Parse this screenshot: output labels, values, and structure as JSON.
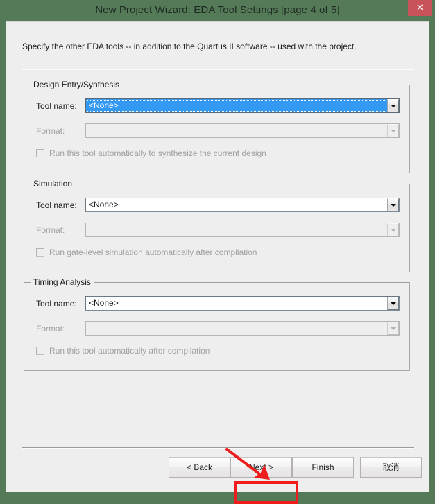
{
  "window": {
    "title": "New Project Wizard: EDA Tool Settings [page 4 of 5]",
    "close_icon": "close-icon",
    "close_glyph": "✕",
    "frame_color": "#557a58",
    "close_button_color": "#c8545a",
    "client_background": "#efeeee"
  },
  "intro": {
    "text": "Specify the other EDA tools -- in addition to the Quartus II software -- used with the project."
  },
  "groups": [
    {
      "legend": "Design Entry/Synthesis",
      "tool_label": "Tool name:",
      "tool_value": "<None>",
      "tool_focused": true,
      "format_label": "Format:",
      "format_value": "",
      "format_disabled": true,
      "checkbox_label": "Run this tool automatically to synthesize the current design",
      "checkbox_checked": false,
      "checkbox_disabled": true
    },
    {
      "legend": "Simulation",
      "tool_label": "Tool name:",
      "tool_value": "<None>",
      "tool_focused": false,
      "format_label": "Format:",
      "format_value": "",
      "format_disabled": true,
      "checkbox_label": "Run gate-level simulation automatically after compilation",
      "checkbox_checked": false,
      "checkbox_disabled": true
    },
    {
      "legend": "Timing Analysis",
      "tool_label": "Tool name:",
      "tool_value": "<None>",
      "tool_focused": false,
      "format_label": "Format:",
      "format_value": "",
      "format_disabled": true,
      "checkbox_label": "Run this tool automatically after compilation",
      "checkbox_checked": false,
      "checkbox_disabled": true
    }
  ],
  "buttons": {
    "back": "< Back",
    "next": "Next >",
    "finish": "Finish",
    "cancel": "取消"
  },
  "annotation": {
    "color": "#ee1c1c",
    "target": "Next >",
    "shapes": [
      "arrow",
      "highlight-box"
    ]
  },
  "colors": {
    "selection_blue": "#3399f3",
    "title_green": "#557a58",
    "close_red": "#c8545a",
    "annotation_red": "#ee1c1c",
    "disabled_text": "#a0a0a0"
  }
}
